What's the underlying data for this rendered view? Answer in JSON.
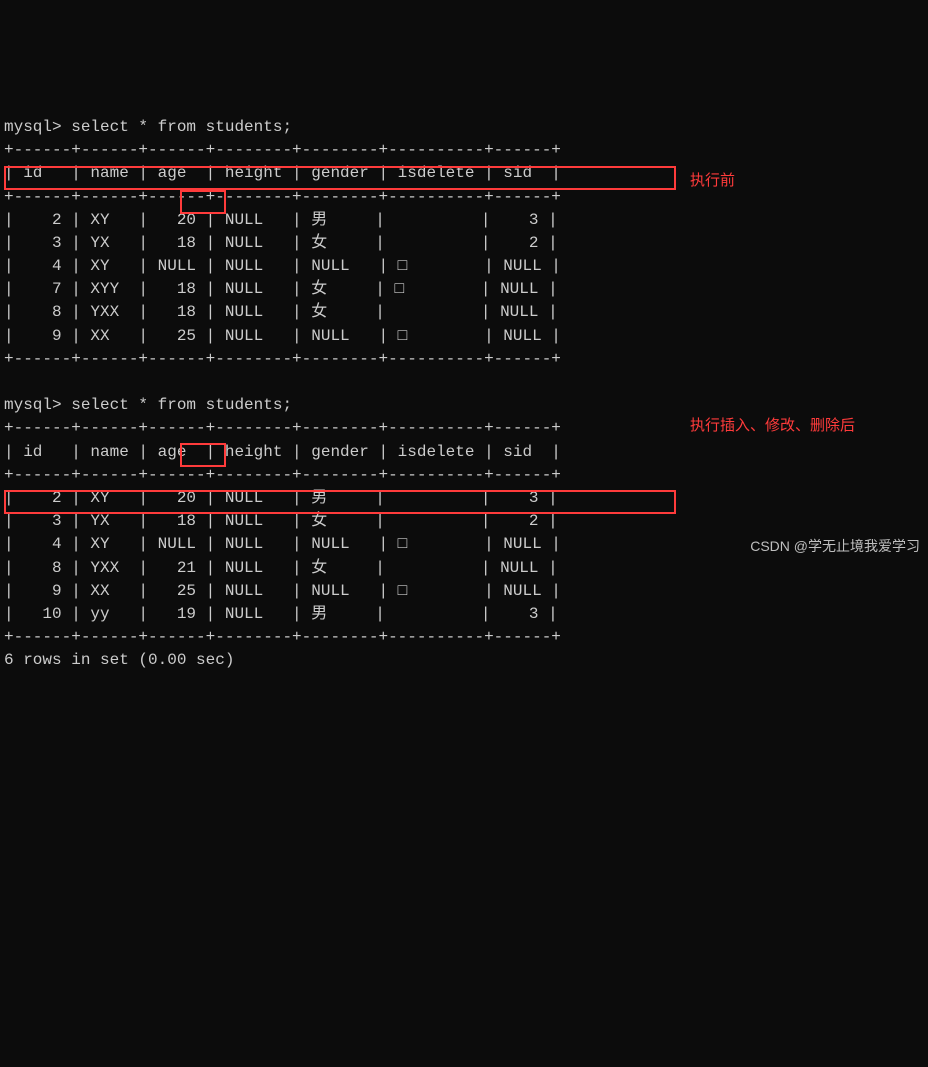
{
  "prompt1": "mysql> select * from students;",
  "prompt2": "mysql> select * from students;",
  "sep_top": "+------+------+------+--------+--------+----------+------+",
  "header": "| id   | name | age  | height | gender | isdelete | sid  |",
  "sep_mid": "+------+------+------+--------+--------+----------+------+",
  "before_rows": [
    "|    2 | XY   |   20 | NULL   | 男     |          |    3 |",
    "|    3 | YX   |   18 | NULL   | 女     |          |    2 |",
    "|    4 | XY   | NULL | NULL   | NULL   | □        | NULL |",
    "|    7 | XYY  |   18 | NULL   | 女     | □        | NULL |",
    "|    8 | YXX  |   18 | NULL   | 女     |          | NULL |",
    "|    9 | XX   |   25 | NULL   | NULL   | □        | NULL |"
  ],
  "after_rows": [
    "|    2 | XY   |   20 | NULL   | 男     |          |    3 |",
    "|    3 | YX   |   18 | NULL   | 女     |          |    2 |",
    "|    4 | XY   | NULL | NULL   | NULL   | □        | NULL |",
    "|    8 | YXX  |   21 | NULL   | 女     |          | NULL |",
    "|    9 | XX   |   25 | NULL   | NULL   | □        | NULL |",
    "|   10 | yy   |   19 | NULL   | 男     |          |    3 |"
  ],
  "footer": "6 rows in set (0.00 sec)",
  "ann_before": "执行前",
  "ann_after": "执行插入、修改、删除后",
  "watermark": "CSDN @学无止境我爱学习",
  "chart_data": {
    "type": "table",
    "title": "students (before / after)",
    "columns": [
      "id",
      "name",
      "age",
      "height",
      "gender",
      "isdelete",
      "sid"
    ],
    "before": [
      {
        "id": 2,
        "name": "XY",
        "age": 20,
        "height": null,
        "gender": "男",
        "isdelete": null,
        "sid": 3
      },
      {
        "id": 3,
        "name": "YX",
        "age": 18,
        "height": null,
        "gender": "女",
        "isdelete": null,
        "sid": 2
      },
      {
        "id": 4,
        "name": "XY",
        "age": null,
        "height": null,
        "gender": null,
        "isdelete": false,
        "sid": null
      },
      {
        "id": 7,
        "name": "XYY",
        "age": 18,
        "height": null,
        "gender": "女",
        "isdelete": false,
        "sid": null
      },
      {
        "id": 8,
        "name": "YXX",
        "age": 18,
        "height": null,
        "gender": "女",
        "isdelete": null,
        "sid": null
      },
      {
        "id": 9,
        "name": "XX",
        "age": 25,
        "height": null,
        "gender": null,
        "isdelete": false,
        "sid": null
      }
    ],
    "after": [
      {
        "id": 2,
        "name": "XY",
        "age": 20,
        "height": null,
        "gender": "男",
        "isdelete": null,
        "sid": 3
      },
      {
        "id": 3,
        "name": "YX",
        "age": 18,
        "height": null,
        "gender": "女",
        "isdelete": null,
        "sid": 2
      },
      {
        "id": 4,
        "name": "XY",
        "age": null,
        "height": null,
        "gender": null,
        "isdelete": false,
        "sid": null
      },
      {
        "id": 8,
        "name": "YXX",
        "age": 21,
        "height": null,
        "gender": "女",
        "isdelete": null,
        "sid": null
      },
      {
        "id": 9,
        "name": "XX",
        "age": 25,
        "height": null,
        "gender": null,
        "isdelete": false,
        "sid": null
      },
      {
        "id": 10,
        "name": "yy",
        "age": 19,
        "height": null,
        "gender": "男",
        "isdelete": null,
        "sid": 3
      }
    ]
  }
}
